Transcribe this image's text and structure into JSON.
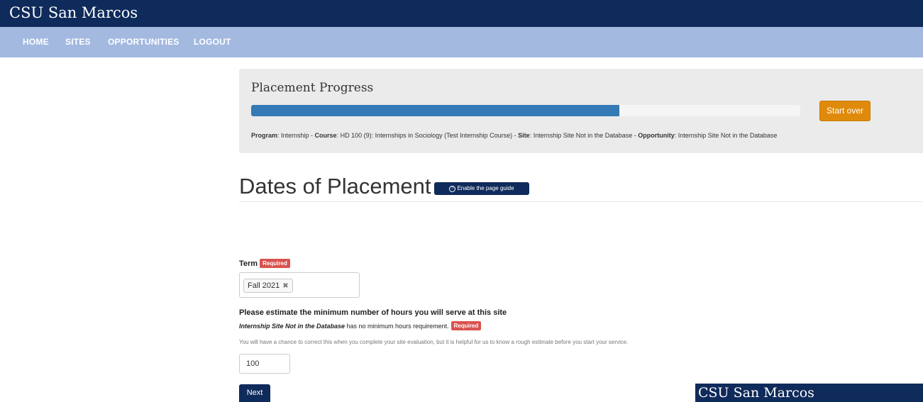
{
  "header": {
    "brand": "CSU San Marcos"
  },
  "nav": {
    "items": [
      {
        "label": "HOME"
      },
      {
        "label": "SITES"
      },
      {
        "label": "OPPORTUNITIES"
      },
      {
        "label": "LOGOUT"
      }
    ]
  },
  "progress": {
    "title": "Placement Progress",
    "percent": 67,
    "start_over_label": "Start over",
    "summary": {
      "program_label": "Program",
      "program_value": ": Internship - ",
      "course_label": "Course",
      "course_value": ": HD 100 (9): Internships in Sociology (Test Internship Course) - ",
      "site_label": "Site",
      "site_value": ": Internship Site Not in the Database - ",
      "opportunity_label": "Opportunity",
      "opportunity_value": ": Internship Site Not in the Database"
    },
    "colors": {
      "fill": "#337ab7",
      "start_over": "#e08a0b"
    }
  },
  "page": {
    "title": "Dates of Placement",
    "guide_button": "Enable the page guide",
    "guide_icon": "question-circle-icon"
  },
  "form": {
    "term": {
      "label": "Term",
      "required_badge": "Required",
      "selected": "Fall 2021",
      "remove_symbol": "✖"
    },
    "hours": {
      "label": "Please estimate the minimum number of hours you will serve at this site",
      "site_name": "Internship Site Not in the Database",
      "note": " has no minimum hours requirement.",
      "required_badge": "Required",
      "help": "You will have a chance to correct this when you complete your site evaluation, but it is helpful for us to know a rough estimate before you start your service.",
      "value": "100"
    },
    "next_label": "Next"
  },
  "footer": {
    "brand": "CSU San Marcos"
  },
  "colors": {
    "navy": "#0f2b5b",
    "nav_bg": "#a3b9e0",
    "required": "#d9534f"
  }
}
